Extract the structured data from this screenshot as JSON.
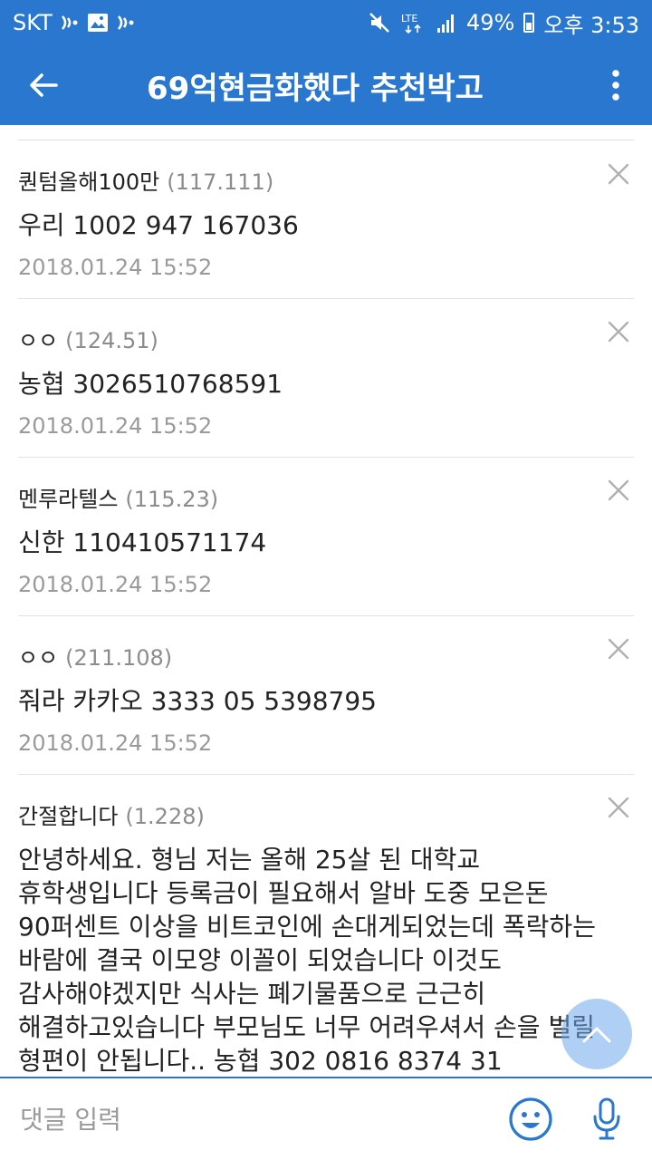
{
  "status_bar": {
    "carrier": "SKT",
    "network": "LTE",
    "battery": "49%",
    "time": "오후 3:53",
    "icons": [
      "wifi-call-icon",
      "image-icon",
      "wifi-call-icon",
      "mute-icon",
      "lte-icon",
      "signal-icon",
      "battery-icon"
    ]
  },
  "app_bar": {
    "title": "69억현금화했다 추천박고",
    "back_icon": "arrow-left-icon",
    "menu_icon": "more-vert-icon"
  },
  "comments": [
    {
      "author": "퀀텀올해100만",
      "score": "(117.111)",
      "body": "우리 1002 947 167036",
      "date": "2018.01.24 15:52"
    },
    {
      "author": "ㅇㅇ",
      "score": "(124.51)",
      "body": "농협 3026510768591",
      "date": "2018.01.24 15:52"
    },
    {
      "author": "멘루라텔스",
      "score": "(115.23)",
      "body": "신한 110410571174",
      "date": "2018.01.24 15:52"
    },
    {
      "author": "ㅇㅇ",
      "score": "(211.108)",
      "body": "줘라 카카오 3333 05 5398795",
      "date": "2018.01.24 15:52"
    },
    {
      "author": "간절합니다",
      "score": "(1.228)",
      "body_lines": [
        "안녕하세요. 형님 저는 올해 25살 된 대학교",
        "휴학생입니다 등록금이 필요해서 알바 도중 모은돈",
        "90퍼센트 이상을 비트코인에 손대게되었는데 폭락하는",
        "바람에 결국 이모양 이꼴이 되었습니다 이것도",
        "감사해야겠지만 식사는 폐기물품으로 근근히",
        "해결하고있습니다 부모님도 너무 어려우셔서 손을 벌릴",
        "형편이 안됩니다.. 농협 302 0816 8374 31"
      ]
    }
  ],
  "input_bar": {
    "placeholder": "댓글 입력",
    "emoji_icon": "emoji-icon",
    "mic_icon": "microphone-icon"
  },
  "colors": {
    "primary": "#2a77cf",
    "divider": "#e2e2e2",
    "muted_text": "#9a9a9a"
  }
}
